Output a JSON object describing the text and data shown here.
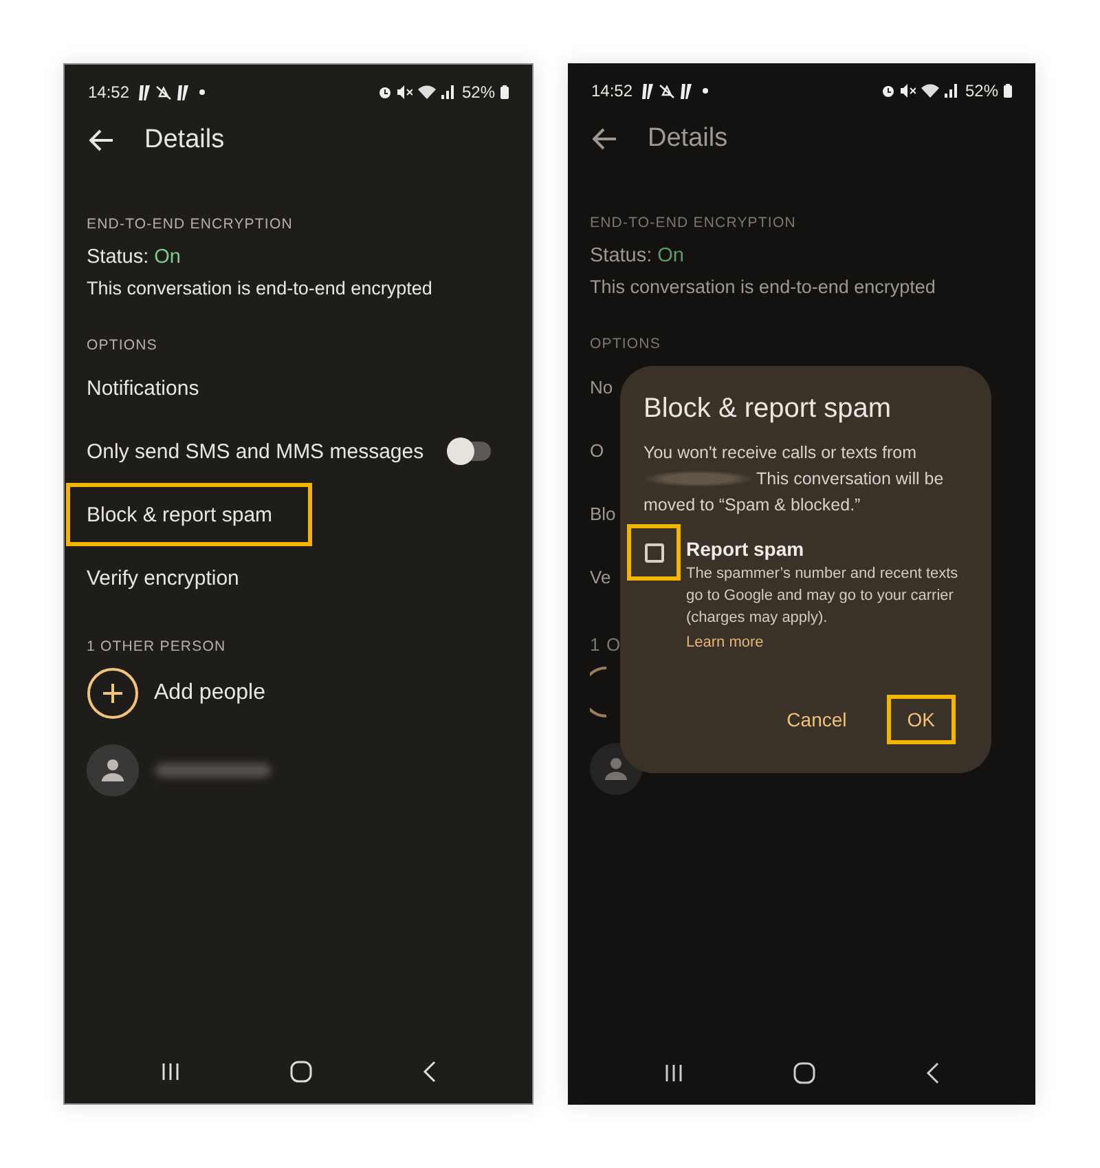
{
  "left_screen": {
    "status_bar": {
      "time": "14:52",
      "battery": "52%"
    },
    "header": {
      "title": "Details"
    },
    "encryption": {
      "heading": "END-TO-END ENCRYPTION",
      "status_label": "Status:",
      "status_value": "On",
      "description": "This conversation is end-to-end encrypted"
    },
    "options": {
      "heading": "OPTIONS",
      "items": [
        {
          "kind": "text",
          "label": "Notifications",
          "highlighted": false
        },
        {
          "kind": "toggle",
          "label": "Only send SMS and MMS messages",
          "on": false,
          "highlighted": false
        },
        {
          "kind": "text",
          "label": "Block & report spam",
          "highlighted": true
        },
        {
          "kind": "text",
          "label": "Verify encryption",
          "highlighted": false
        }
      ]
    },
    "people": {
      "heading": "1 OTHER PERSON",
      "add_label": "Add people"
    }
  },
  "right_screen": {
    "status_bar": {
      "time": "14:52",
      "battery": "52%"
    },
    "header": {
      "title": "Details"
    },
    "encryption": {
      "heading": "END-TO-END ENCRYPTION",
      "status_label": "Status:",
      "status_value": "On",
      "description": "This conversation is end-to-end encrypted"
    },
    "options": {
      "heading": "OPTIONS",
      "items": [
        {
          "label": "No"
        },
        {
          "label": "O"
        },
        {
          "label": "Blo"
        },
        {
          "label": "Ve"
        }
      ]
    },
    "people": {
      "heading": "1 O"
    },
    "dialog": {
      "title": "Block & report spam",
      "message_start": "You won't receive calls or texts from",
      "message_end": "This conversation will be moved to “Spam & blocked.”",
      "checkbox": {
        "label": "Report spam",
        "checked": false,
        "highlighted": true,
        "description": "The spammer’s number and recent texts go to Google and may go to your carrier (charges may apply).",
        "link": "Learn more"
      },
      "buttons": [
        {
          "label": "Cancel",
          "highlighted": false
        },
        {
          "label": "OK",
          "highlighted": true
        }
      ]
    }
  }
}
